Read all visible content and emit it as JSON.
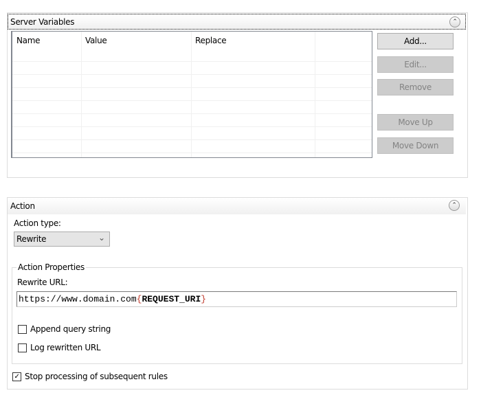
{
  "server_variables": {
    "title": "Server Variables",
    "columns": [
      "Name",
      "Value",
      "Replace"
    ],
    "buttons": {
      "add": "Add...",
      "edit": "Edit...",
      "remove": "Remove",
      "move_up": "Move Up",
      "move_down": "Move Down"
    }
  },
  "action": {
    "title": "Action",
    "action_type_label": "Action type:",
    "action_type_value": "Rewrite",
    "properties_legend": "Action Properties",
    "rewrite_url_label": "Rewrite URL:",
    "rewrite_url_prefix": "https://www.domain.com",
    "rewrite_url_open": "{",
    "rewrite_url_var": "REQUEST_URI",
    "rewrite_url_close": "}",
    "append_query_string": "Append query string",
    "append_query_checked": false,
    "log_rewritten": "Log rewritten URL",
    "log_checked": false,
    "stop_processing": "Stop processing of subsequent rules",
    "stop_checked": true,
    "check_mark": "✓"
  },
  "icons": {
    "collapse": "⌃",
    "chevron": "⌄"
  }
}
